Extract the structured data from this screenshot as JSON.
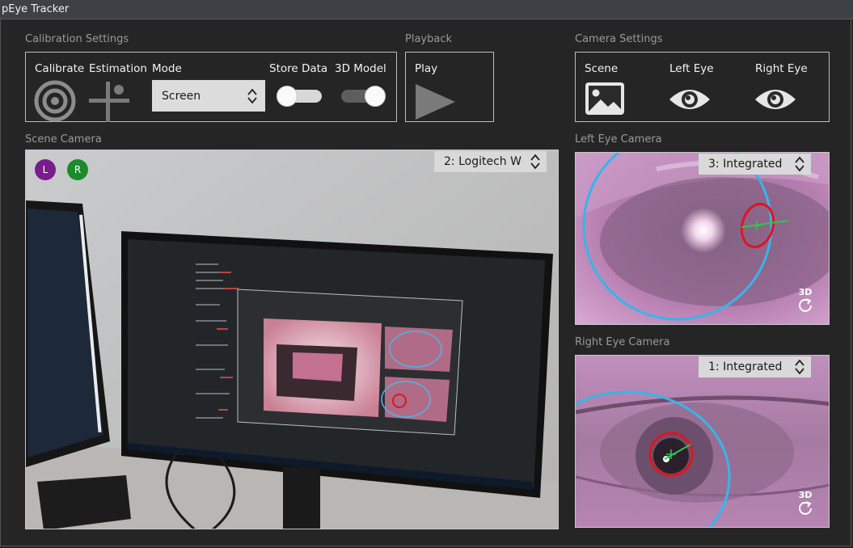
{
  "window": {
    "title": "pEye Tracker"
  },
  "calibration": {
    "section_label": "Calibration Settings",
    "calibrate_label": "Calibrate",
    "estimation_label": "Estimation",
    "mode_label": "Mode",
    "mode_value": "Screen",
    "store_data_label": "Store Data",
    "model3d_label": "3D Model",
    "store_data_on": false,
    "model3d_on": true
  },
  "playback": {
    "section_label": "Playback",
    "play_label": "Play"
  },
  "camera_settings": {
    "section_label": "Camera Settings",
    "scene_label": "Scene",
    "left_eye_label": "Left Eye",
    "right_eye_label": "Right Eye"
  },
  "scene_camera": {
    "section_label": "Scene Camera",
    "source": "2: Logitech W",
    "left_marker": "L",
    "right_marker": "R"
  },
  "left_eye_camera": {
    "section_label": "Left Eye Camera",
    "source": "3: Integrated",
    "reset_label": "3D"
  },
  "right_eye_camera": {
    "section_label": "Right Eye Camera",
    "source": "1: Integrated",
    "reset_label": "3D"
  },
  "colors": {
    "background": "#252525",
    "left_marker": "#7a1c8c",
    "right_marker": "#1b8a2a",
    "pupil_ring": "#e0141e",
    "iris_ring": "#2fb6ee",
    "gaze_line": "#2ec84a"
  }
}
